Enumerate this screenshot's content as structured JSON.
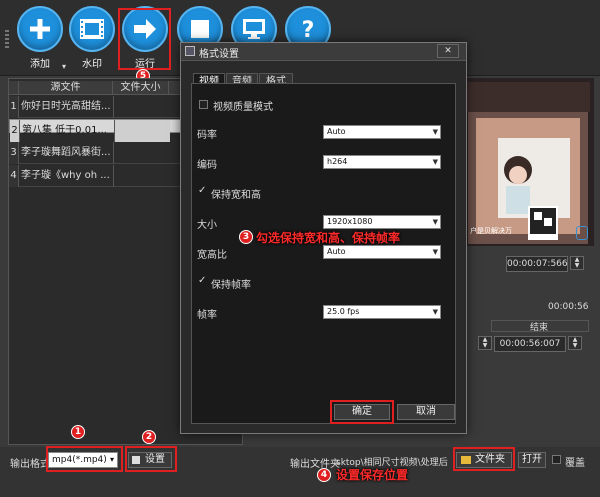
{
  "toolbar": {
    "add_label": "添加",
    "watermark_label": "水印",
    "run_label": "运行",
    "stop_label": "",
    "preview_label": "",
    "help_label": "",
    "badge_run": "5"
  },
  "file_list": {
    "col_source": "源文件",
    "col_size": "文件大小",
    "rows": [
      {
        "num": "1",
        "name": "你好日时光高甜结..."
      },
      {
        "num": "2",
        "name": "第八集 低于0.01..."
      },
      {
        "num": "3",
        "name": "李子璇舞蹈风暴街..."
      },
      {
        "num": "4",
        "name": "李子璇《why oh ..."
      }
    ]
  },
  "preview": {
    "watermark_text": "户是贝解决万",
    "time_display": "00:00:07:566",
    "duration": "00:00:56",
    "end_label": "结束",
    "end_time": "00:00:56:007"
  },
  "dialog": {
    "title": "格式设置",
    "close_glyph": "✕",
    "tabs": [
      "视频",
      "音频",
      "格式"
    ],
    "video_quality_mode": "视频质量模式",
    "bitrate_label": "码率",
    "bitrate_value": "Auto",
    "codec_label": "编码",
    "codec_value": "h264",
    "keep_aspect_label": "保持宽和高",
    "size_label": "大小",
    "size_value": "1920x1080",
    "aspect_label": "宽高比",
    "aspect_value": "Auto",
    "keep_fps_label": "保持帧率",
    "fps_label": "帧率",
    "fps_value": "25.0 fps",
    "ok_label": "确定",
    "cancel_label": "取消"
  },
  "bottom": {
    "output_format_label": "输出格式",
    "output_format_value": "mp4(*.mp4)",
    "settings_label": "设置",
    "output_folder_label": "输出文件夹",
    "output_folder_value": "sktop\\相同尺寸视频\\处理后",
    "folder_button": "文件夹",
    "open_button": "打开",
    "overwrite_label": "覆盖"
  },
  "annotations": {
    "badge1": "1",
    "badge2": "2",
    "badge3": "3",
    "badge4": "4",
    "callout3": "勾选保持宽和高、保持帧率",
    "callout4": "设置保存位置"
  },
  "colors": {
    "accent": "#1e8fdb",
    "annotation_red": "#e02020"
  }
}
